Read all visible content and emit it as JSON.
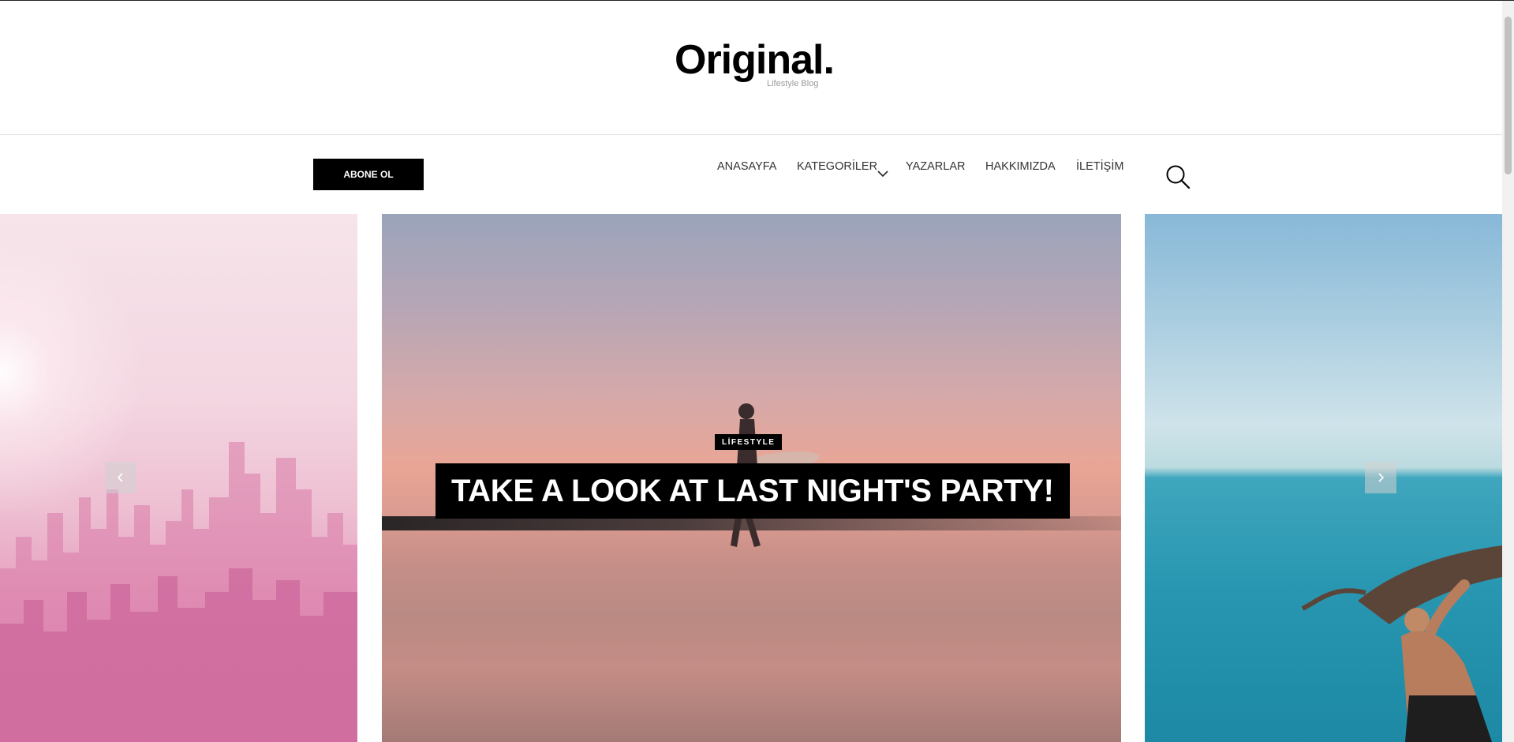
{
  "header": {
    "logo": "Original.",
    "tagline": "Lifestyle Blog"
  },
  "nav": {
    "subscribe_label": "ABONE OL",
    "items": [
      {
        "label": "ANASAYFA"
      },
      {
        "label": "KATEGORİLER"
      },
      {
        "label": "YAZARLAR"
      },
      {
        "label": "HAKKIMIZDA"
      },
      {
        "label": "İLETİŞİM"
      }
    ],
    "icons": {
      "dropdown": "chevron-down-icon",
      "search": "search-icon"
    }
  },
  "slider": {
    "active_slide": {
      "category": "LİFESTYLE",
      "title": "TAKE A LOOK AT LAST NIGHT'S PARTY!"
    },
    "icons": {
      "prev": "chevron-left-icon",
      "next": "chevron-right-icon"
    }
  },
  "colors": {
    "accent": "#000000",
    "text": "#333333",
    "tagline": "#9a9a9a"
  }
}
